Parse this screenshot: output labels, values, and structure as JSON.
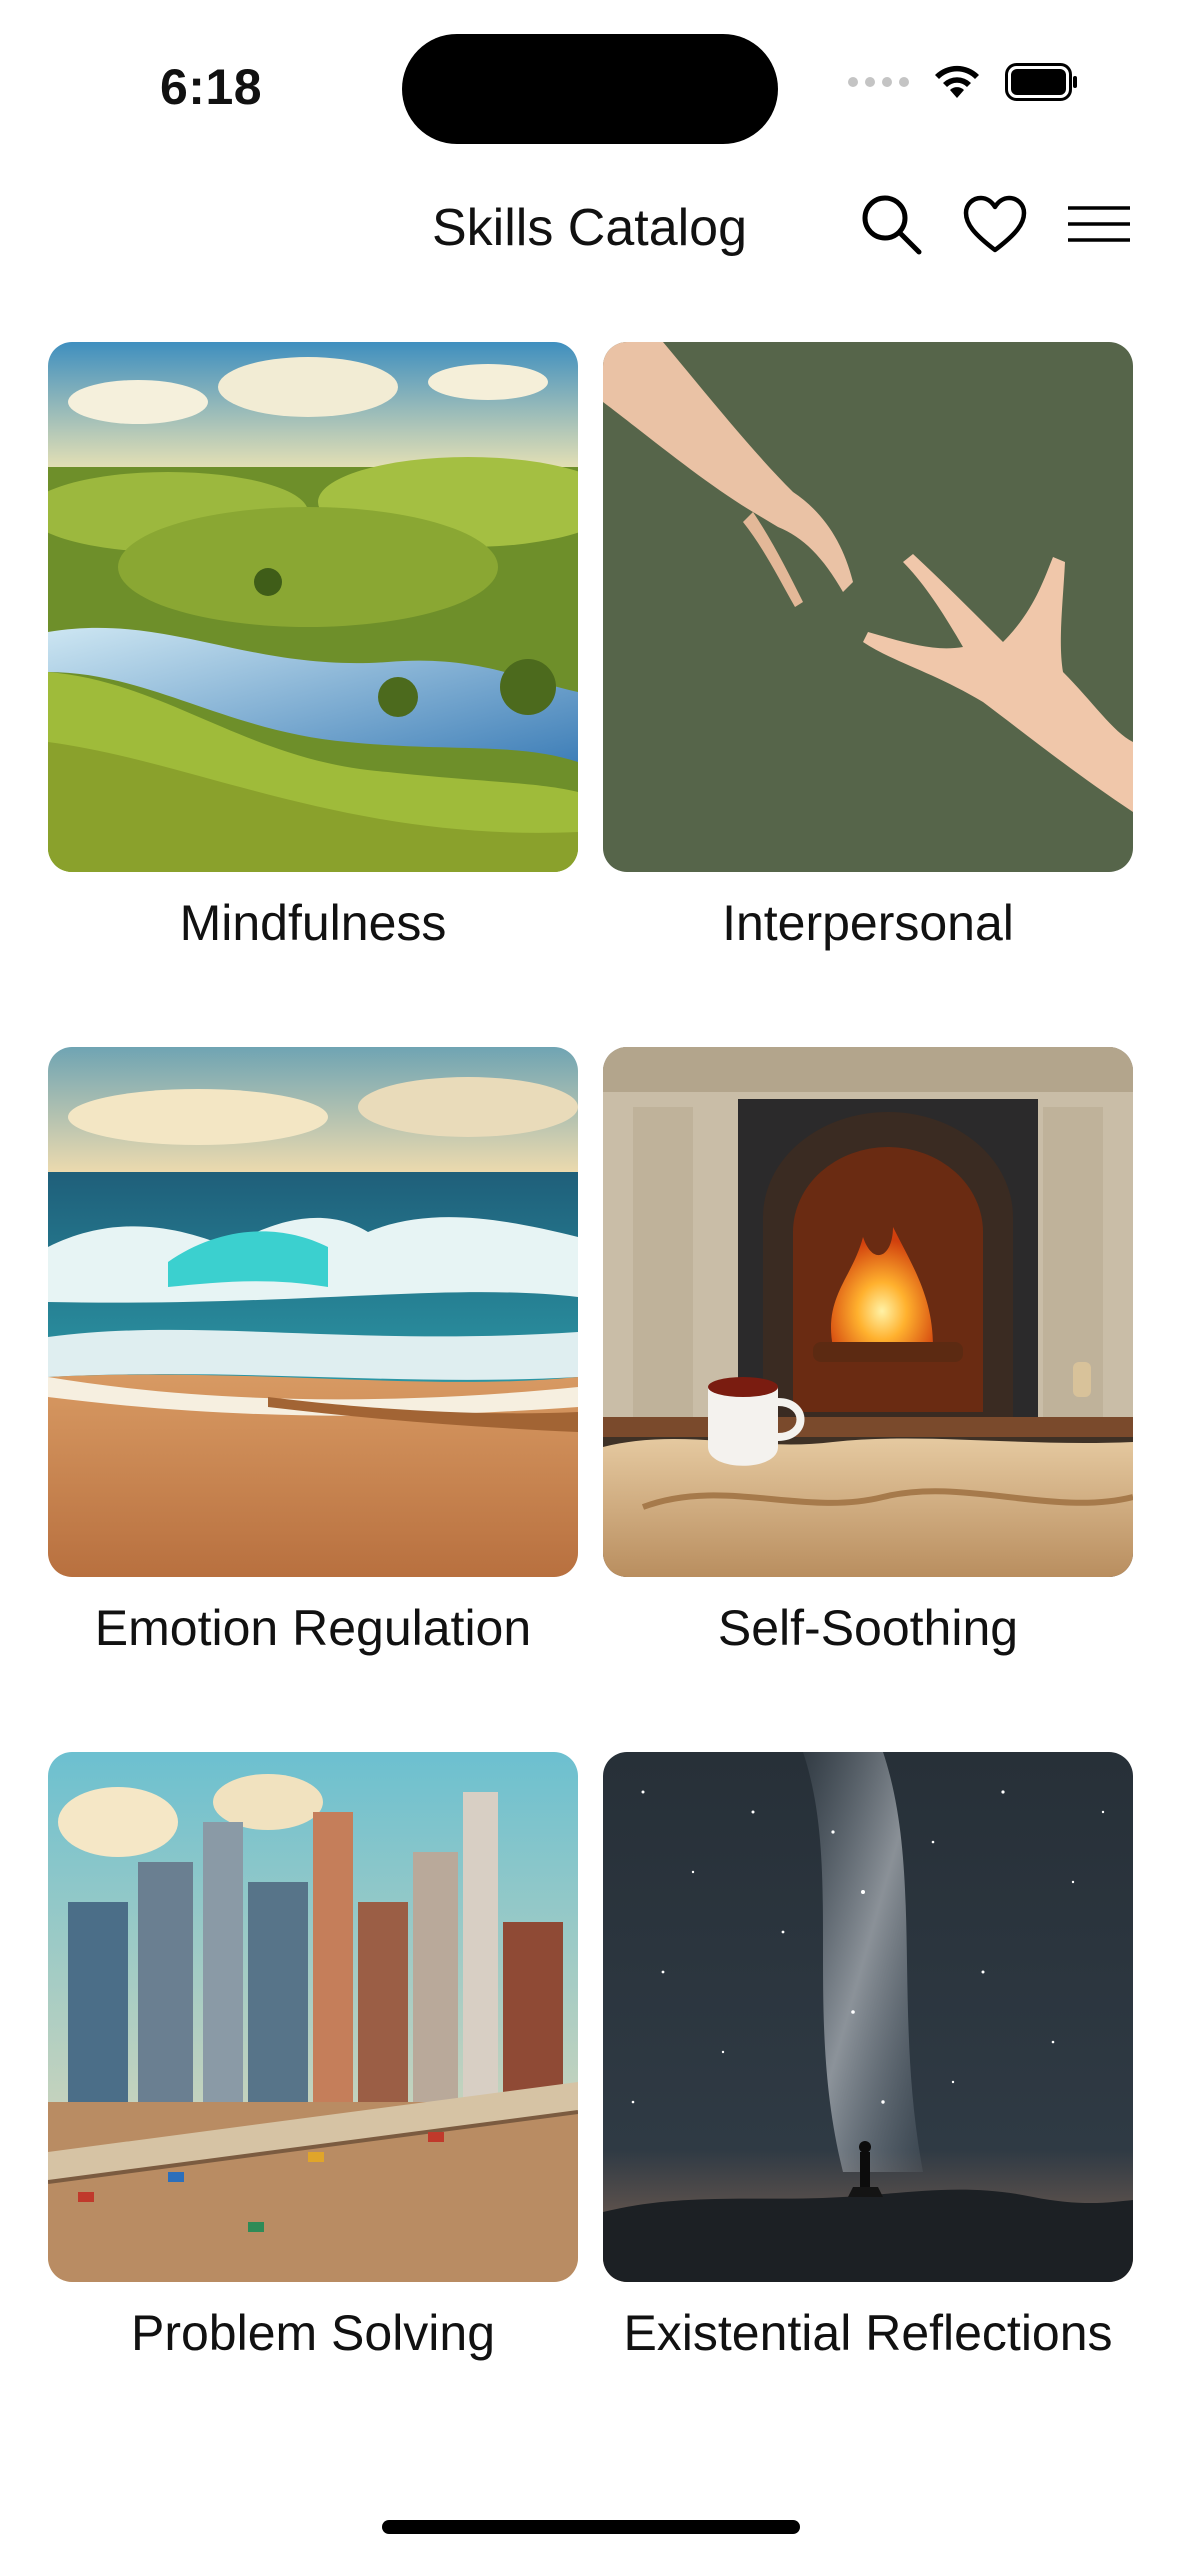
{
  "status_bar": {
    "time": "6:18",
    "icons": [
      "signal-dots-icon",
      "wifi-icon",
      "battery-icon"
    ]
  },
  "header": {
    "title": "Skills Catalog",
    "actions": [
      "search-icon",
      "heart-icon",
      "hamburger-menu-icon"
    ]
  },
  "catalog": {
    "items": [
      {
        "label": "Mindfulness",
        "image": "rolling green hills with a winding river"
      },
      {
        "label": "Interpersonal",
        "image": "two hands reaching toward each other on green background"
      },
      {
        "label": "Emotion Regulation",
        "image": "ocean waves crashing on a beach"
      },
      {
        "label": "Self-Soothing",
        "image": "fireplace with a cup of tea on a blanket"
      },
      {
        "label": "Problem Solving",
        "image": "busy city skyline with bridge and traffic"
      },
      {
        "label": "Existential Reflections",
        "image": "milky way starry night sky with lone figure"
      }
    ]
  },
  "colors": {
    "background": "#ffffff",
    "text": "#111111",
    "dynamic_island": "#000000"
  }
}
